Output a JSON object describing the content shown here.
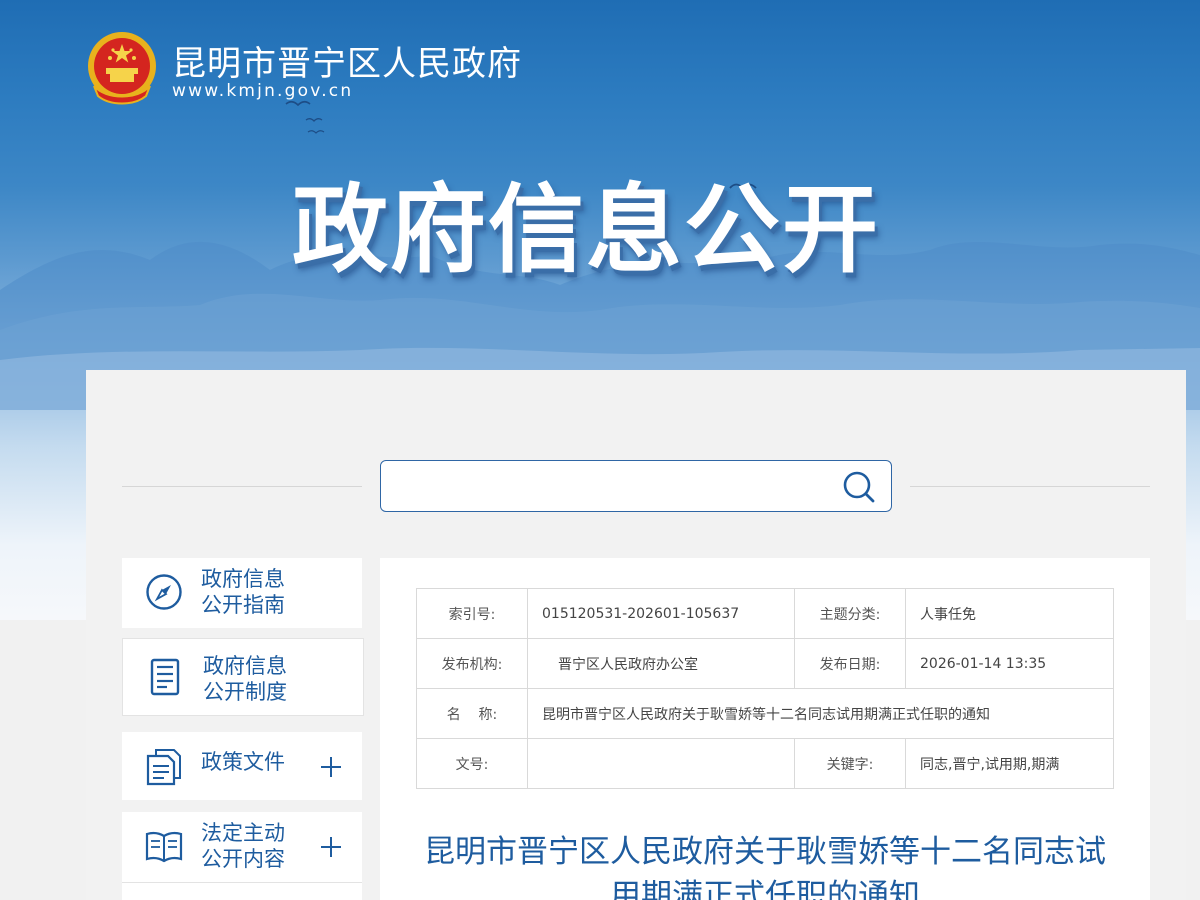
{
  "header": {
    "site_name": "昆明市晋宁区人民政府",
    "site_url": "www.kmjn.gov.cn",
    "emblem_icon": "national-emblem-icon",
    "hero_title": "政府信息公开"
  },
  "search": {
    "value": "",
    "placeholder": "",
    "icon": "search-icon"
  },
  "sidebar": {
    "items": [
      {
        "label_line1": "政府信息",
        "label_line2": "公开指南",
        "icon": "compass-icon",
        "expandable": false
      },
      {
        "label_line1": "政府信息",
        "label_line2": "公开制度",
        "icon": "document-icon",
        "expandable": false
      },
      {
        "label_line1": "政策文件",
        "label_line2": "",
        "icon": "files-icon",
        "expandable": true
      },
      {
        "label_line1": "法定主动",
        "label_line2": "公开内容",
        "icon": "book-icon",
        "expandable": true
      }
    ]
  },
  "meta": {
    "index_label": "索引号:",
    "index_value": "015120531-202601-105637",
    "topic_label": "主题分类:",
    "topic_value": "人事任免",
    "publisher_label": "发布机构:",
    "publisher_value": "晋宁区人民政府办公室",
    "date_label": "发布日期:",
    "date_value": "2026-01-14 13:35",
    "name_label": "名    称:",
    "name_value": "昆明市晋宁区人民政府关于耿雪娇等十二名同志试用期满正式任职的通知",
    "docno_label": "文号:",
    "docno_value": "",
    "keywords_label": "关键字:",
    "keywords_value": "同志,晋宁,试用期,期满"
  },
  "document": {
    "title": "昆明市晋宁区人民政府关于耿雪娇等十二名同志试用期满正式任职的通知"
  },
  "colors": {
    "brand_blue": "#1e5c9f",
    "banner_blue": "#2d7cc0",
    "panel_bg": "#f2f2f2"
  }
}
